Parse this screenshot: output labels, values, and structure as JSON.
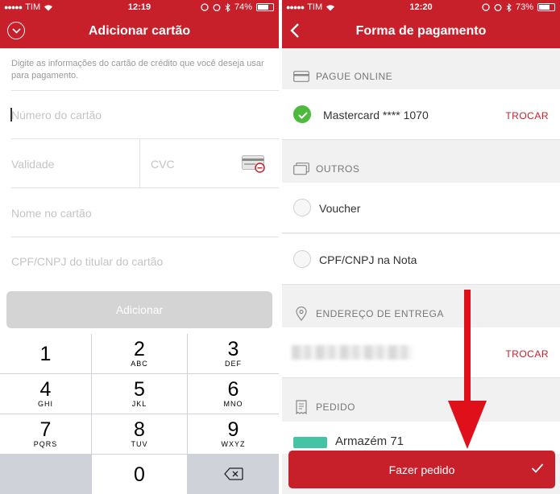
{
  "left": {
    "status": {
      "carrier": "TIM",
      "time": "12:19",
      "battery": "74%",
      "battery_level": 0.74
    },
    "title": "Adicionar cartão",
    "intro": "Digite as informações do cartão de crédito que você deseja usar para pagamento.",
    "fields": {
      "card_number": "Número do cartão",
      "validity": "Validade",
      "cvc": "CVC",
      "name": "Nome no cartão",
      "cpf": "CPF/CNPJ do titular do cartão"
    },
    "add_button": "Adicionar",
    "keys": [
      {
        "num": "1",
        "letters": ""
      },
      {
        "num": "2",
        "letters": "ABC"
      },
      {
        "num": "3",
        "letters": "DEF"
      },
      {
        "num": "4",
        "letters": "GHI"
      },
      {
        "num": "5",
        "letters": "JKL"
      },
      {
        "num": "6",
        "letters": "MNO"
      },
      {
        "num": "7",
        "letters": "PQRS"
      },
      {
        "num": "8",
        "letters": "TUV"
      },
      {
        "num": "9",
        "letters": "WXYZ"
      },
      {
        "num": "0",
        "letters": ""
      }
    ]
  },
  "right": {
    "status": {
      "carrier": "TIM",
      "time": "12:20",
      "battery": "73%",
      "battery_level": 0.73
    },
    "title": "Forma de pagamento",
    "online_header": "PAGUE ONLINE",
    "card_label": "Mastercard **** 1070",
    "change_label": "TROCAR",
    "others_header": "OUTROS",
    "voucher_label": "Voucher",
    "cpf_label": "CPF/CNPJ na Nota",
    "address_header": "ENDEREÇO DE ENTREGA",
    "address_change": "TROCAR",
    "order_header": "PEDIDO",
    "store_name": "Armazém 71",
    "order_button": "Fazer pedido"
  },
  "colors": {
    "brand_red": "#c8202b",
    "check_green": "#4cbb3b"
  }
}
